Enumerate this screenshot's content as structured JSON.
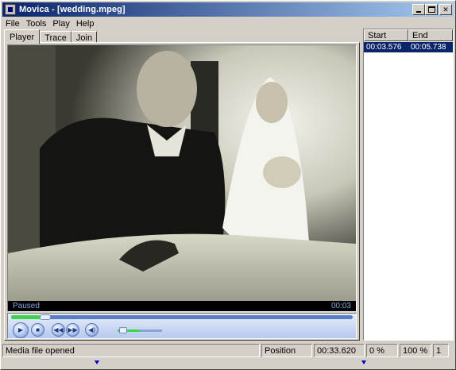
{
  "window": {
    "title": "Movica - [wedding.mpeg]",
    "minimize_icon": "minimize-icon",
    "maximize_icon": "maximize-icon",
    "close_icon": "close-icon"
  },
  "menu": {
    "items": [
      "File",
      "Tools",
      "Play",
      "Help"
    ]
  },
  "tabs": [
    {
      "label": "Player",
      "active": true
    },
    {
      "label": "Trace",
      "active": false
    },
    {
      "label": "Join",
      "active": false
    }
  ],
  "player": {
    "state": "Paused",
    "time": "00:03",
    "seek_fraction": 0.1,
    "volume_fraction": 0.3,
    "buttons": [
      "play-icon",
      "stop-icon",
      "previous-icon",
      "next-icon",
      "mute-icon"
    ]
  },
  "list": {
    "columns": [
      "Start",
      "End"
    ],
    "rows": [
      {
        "start": "00:03.576",
        "end": "00:05.738"
      }
    ]
  },
  "statusbar": {
    "message": "Media file opened",
    "position_label": "Position",
    "position_value": "00:33.620",
    "percent_a": "0 %",
    "percent_b": "100 %",
    "count": "1"
  },
  "colors": {
    "title_active": "#0a246a",
    "selection": "#0a246a",
    "face": "#d4d0c8",
    "marker": "#0000c0"
  }
}
